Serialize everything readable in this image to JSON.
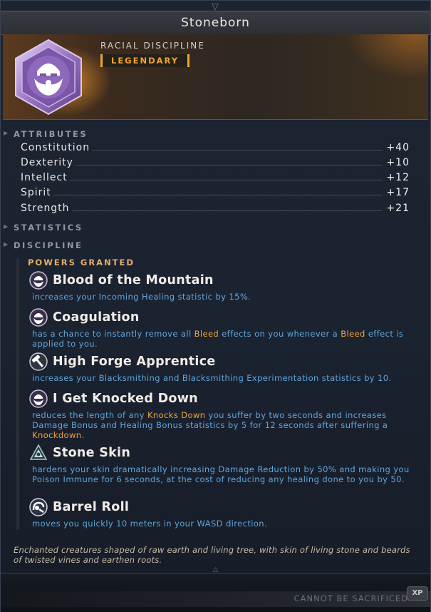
{
  "item": {
    "name": "Stoneborn",
    "category": "RACIAL DISCIPLINE",
    "rarity": "LEGENDARY",
    "icon": "stoneborn-dwarf-face-icon",
    "rarity_color": "#f0a52a"
  },
  "sections": {
    "attributes": "ATTRIBUTES",
    "statistics": "STATISTICS",
    "discipline": "DISCIPLINE",
    "powers_granted": "POWERS GRANTED"
  },
  "attributes": [
    {
      "name": "Constitution",
      "value": "+40"
    },
    {
      "name": "Dexterity",
      "value": "+10"
    },
    {
      "name": "Intellect",
      "value": "+12"
    },
    {
      "name": "Spirit",
      "value": "+17"
    },
    {
      "name": "Strength",
      "value": "+21"
    }
  ],
  "powers": [
    {
      "name": "Blood of the Mountain",
      "icon": "dwarf-face-icon",
      "desc": [
        {
          "t": "increases your Incoming Healing statistic by 15%."
        }
      ]
    },
    {
      "name": "Coagulation",
      "icon": "dwarf-face-icon",
      "desc": [
        {
          "t": "has a chance to instantly remove all "
        },
        {
          "t": "Bleed",
          "hl": true
        },
        {
          "t": " effects on you whenever a "
        },
        {
          "t": "Bleed",
          "hl": true
        },
        {
          "t": " effect is applied to you."
        }
      ]
    },
    {
      "name": "High Forge Apprentice",
      "icon": "hammer-icon",
      "desc": [
        {
          "t": "increases your Blacksmithing and Blacksmithing Experimentation statistics by 10."
        }
      ]
    },
    {
      "name": "I Get Knocked Down",
      "icon": "dwarf-face-icon",
      "desc": [
        {
          "t": "reduces the length of any "
        },
        {
          "t": "Knocks Down",
          "hl": true
        },
        {
          "t": " you suffer by two seconds and increases Damage Bonus and Healing Bonus statistics by 5 for 12 seconds after suffering a "
        },
        {
          "t": "Knockdown",
          "hl": true
        },
        {
          "t": "."
        }
      ]
    },
    {
      "name": "Stone Skin",
      "icon": "stone-skin-icon",
      "desc": [
        {
          "t": "hardens your skin dramatically increasing Damage Reduction by 50% and making you Poison Immune for 6 seconds, at the cost of reducing any healing done to you by 50."
        }
      ]
    },
    {
      "name": "Barrel Roll",
      "icon": "barrel-roll-icon",
      "desc": [
        {
          "t": "moves you quickly 10 meters in your WASD direction."
        }
      ]
    }
  ],
  "flavor_text": "Enchanted creatures shaped of raw earth and living tree, with skin of living stone and beards of twisted vines and earthen roots.",
  "footer": {
    "sacrifice_status": "CANNOT BE SACRIFICED",
    "xp_badge": "XP"
  },
  "colors": {
    "highlight": "#f0a63a",
    "description": "#5fa7dc",
    "powers_heading": "#e3b06a"
  }
}
